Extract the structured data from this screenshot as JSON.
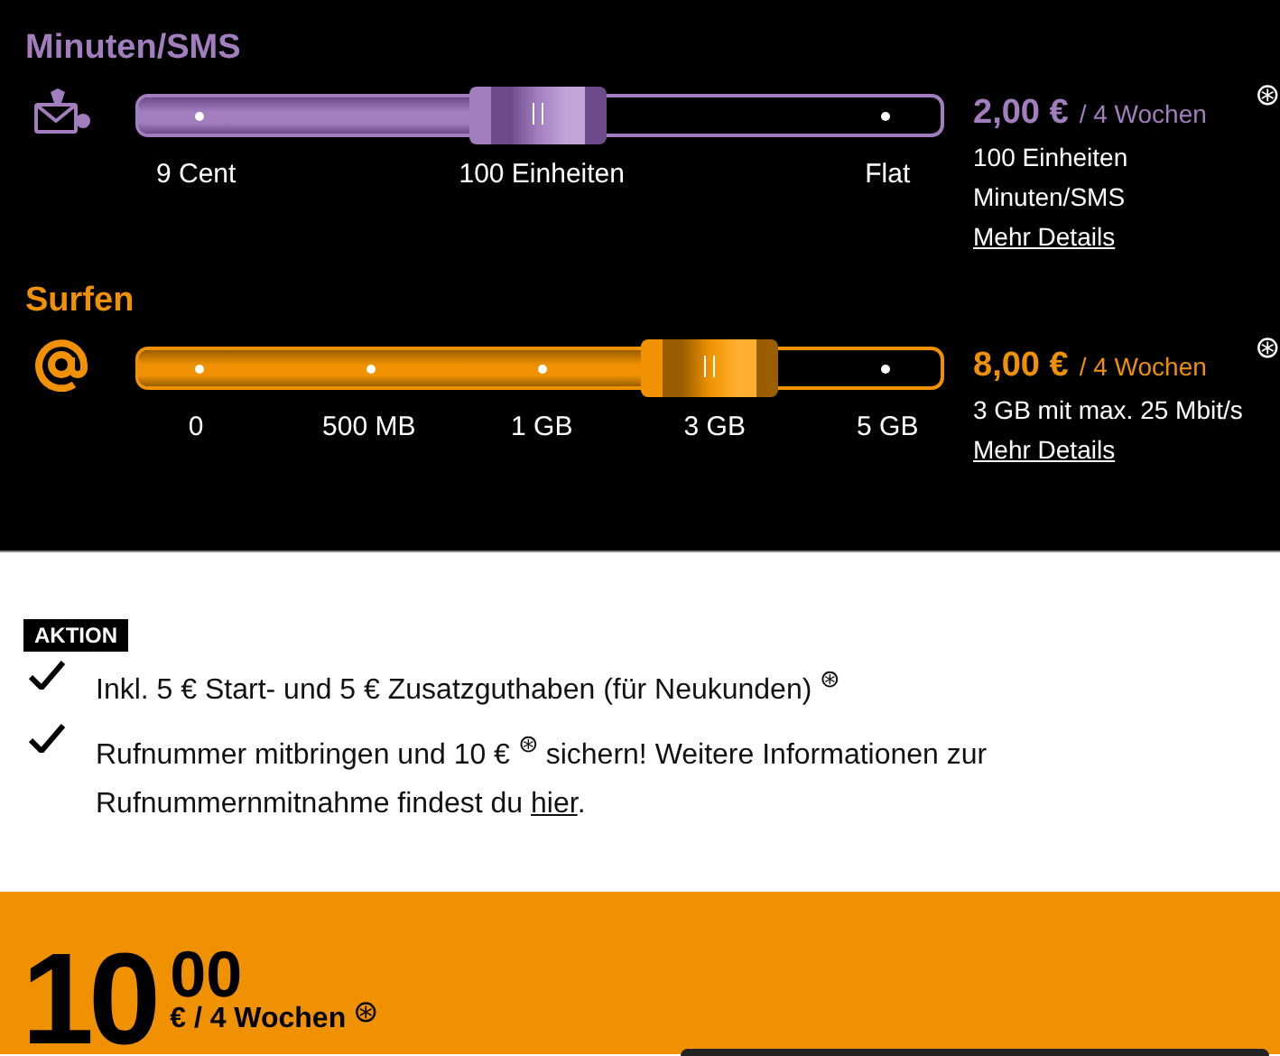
{
  "sliders": [
    {
      "kind": "minutes",
      "title": "Minuten/SMS",
      "level": 0.497,
      "ticks": [
        "9 Cent",
        "100 Einheiten",
        "Flat"
      ],
      "price": "2,00 €",
      "period": "/ 4 Wochen",
      "mark": "⊛",
      "details": [
        "100 Einheiten",
        "Minuten/SMS"
      ],
      "link": "Mehr Details"
    },
    {
      "kind": "data",
      "title": "Surfen",
      "level": 0.71,
      "ticks": [
        "0",
        "500 MB",
        "1 GB",
        "3 GB",
        "5 GB"
      ],
      "price": "8,00 €",
      "period": "/ 4 Wochen",
      "mark": "⊛",
      "details": [
        "3 GB mit max. 25 Mbit/s"
      ],
      "link": "Mehr Details"
    }
  ],
  "promo": {
    "badge": "AKTION",
    "items": [
      {
        "text": "Inkl. 5 € Start- und 5 € Zusatzguthaben (für Neukunden) $^{⊛}$"
      },
      {
        "text": "Rufnummer mitbringen und 10 € $^{⊛}$ sichern! Weitere Informationen zur Rufnummernmitnahme findest du",
        "link": "hier",
        "after": "."
      }
    ]
  },
  "total": {
    "euros": "10",
    "cents": "00",
    "period": "€ / 4 Wochen",
    "mark": "⊛"
  }
}
